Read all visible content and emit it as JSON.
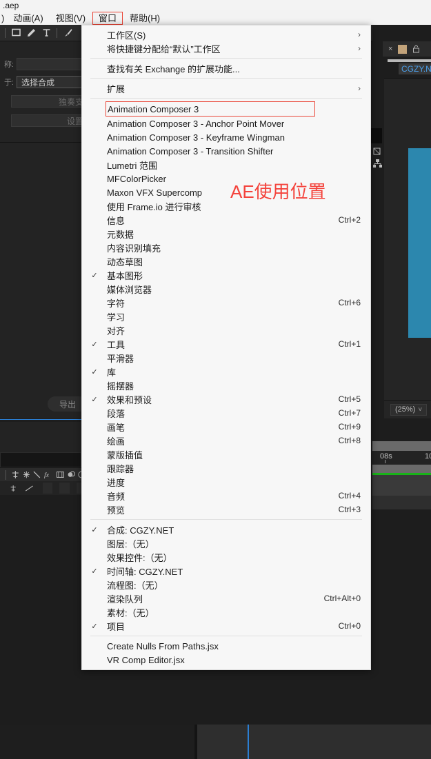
{
  "window": {
    "title": ".aep",
    "menubar": [
      {
        "label": ")",
        "active": false
      },
      {
        "label": "动画(A)",
        "active": false
      },
      {
        "label": "视图(V)",
        "active": false
      },
      {
        "label": "窗口",
        "active": true
      },
      {
        "label": "帮助(H)",
        "active": false
      }
    ]
  },
  "toolbar": {
    "tools": [
      "rectangle-tool",
      "pen-tool",
      "text-tool",
      "brush-tool"
    ]
  },
  "left_panel": {
    "rows": [
      {
        "label": "称:",
        "value": "",
        "placeholder": ""
      },
      {
        "label": "于:",
        "value": "选择合成",
        "placeholder": ""
      },
      {
        "label": "",
        "value": "独奏支",
        "placeholder": ""
      },
      {
        "label": "",
        "value": "设置",
        "placeholder": ""
      }
    ],
    "export_label": "导出"
  },
  "right_panel": {
    "comp_name": "CGZY.N",
    "zoom_level": "(25%)",
    "zoom_caret": "˅",
    "close_icon": "×",
    "lock_icon": "🔓"
  },
  "timeline": {
    "ruler_labels": [
      "08s",
      "10"
    ]
  },
  "annotation": {
    "text": "AE使用位置",
    "color": "#f4433c"
  },
  "menu": {
    "name": "window-menu",
    "groups": [
      {
        "items": [
          {
            "label": "工作区(S)",
            "accel": "",
            "checked": false,
            "submenu": true
          },
          {
            "label": "将快捷键分配给“默认”工作区",
            "accel": "",
            "checked": false,
            "submenu": true
          }
        ]
      },
      {
        "items": [
          {
            "label": "查找有关 Exchange 的扩展功能...",
            "accel": "",
            "checked": false,
            "submenu": false
          }
        ]
      },
      {
        "items": [
          {
            "label": "扩展",
            "accel": "",
            "checked": false,
            "submenu": true
          }
        ]
      },
      {
        "items": [
          {
            "label": "Animation Composer 3",
            "accel": "",
            "checked": false,
            "submenu": false,
            "highlight": true
          },
          {
            "label": "Animation Composer 3 - Anchor Point Mover",
            "accel": "",
            "checked": false,
            "submenu": false
          },
          {
            "label": "Animation Composer 3 - Keyframe Wingman",
            "accel": "",
            "checked": false,
            "submenu": false
          },
          {
            "label": "Animation Composer 3 - Transition Shifter",
            "accel": "",
            "checked": false,
            "submenu": false
          },
          {
            "label": "Lumetri 范围",
            "accel": "",
            "checked": false,
            "submenu": false
          },
          {
            "label": "MFColorPicker",
            "accel": "",
            "checked": false,
            "submenu": false
          },
          {
            "label": "Maxon VFX Supercomp",
            "accel": "",
            "checked": false,
            "submenu": false
          },
          {
            "label": "使用 Frame.io 进行审核",
            "accel": "",
            "checked": false,
            "submenu": false
          },
          {
            "label": "信息",
            "accel": "Ctrl+2",
            "checked": false,
            "submenu": false
          },
          {
            "label": "元数据",
            "accel": "",
            "checked": false,
            "submenu": false
          },
          {
            "label": "内容识别填充",
            "accel": "",
            "checked": false,
            "submenu": false
          },
          {
            "label": "动态草图",
            "accel": "",
            "checked": false,
            "submenu": false
          },
          {
            "label": "基本图形",
            "accel": "",
            "checked": true,
            "submenu": false
          },
          {
            "label": "媒体浏览器",
            "accel": "",
            "checked": false,
            "submenu": false
          },
          {
            "label": "字符",
            "accel": "Ctrl+6",
            "checked": false,
            "submenu": false
          },
          {
            "label": "学习",
            "accel": "",
            "checked": false,
            "submenu": false
          },
          {
            "label": "对齐",
            "accel": "",
            "checked": false,
            "submenu": false
          },
          {
            "label": "工具",
            "accel": "Ctrl+1",
            "checked": true,
            "submenu": false
          },
          {
            "label": "平滑器",
            "accel": "",
            "checked": false,
            "submenu": false
          },
          {
            "label": "库",
            "accel": "",
            "checked": true,
            "submenu": false
          },
          {
            "label": "摇摆器",
            "accel": "",
            "checked": false,
            "submenu": false
          },
          {
            "label": "效果和预设",
            "accel": "Ctrl+5",
            "checked": true,
            "submenu": false
          },
          {
            "label": "段落",
            "accel": "Ctrl+7",
            "checked": false,
            "submenu": false
          },
          {
            "label": "画笔",
            "accel": "Ctrl+9",
            "checked": false,
            "submenu": false
          },
          {
            "label": "绘画",
            "accel": "Ctrl+8",
            "checked": false,
            "submenu": false
          },
          {
            "label": "蒙版插值",
            "accel": "",
            "checked": false,
            "submenu": false
          },
          {
            "label": "跟踪器",
            "accel": "",
            "checked": false,
            "submenu": false
          },
          {
            "label": "进度",
            "accel": "",
            "checked": false,
            "submenu": false
          },
          {
            "label": "音频",
            "accel": "Ctrl+4",
            "checked": false,
            "submenu": false
          },
          {
            "label": "预览",
            "accel": "Ctrl+3",
            "checked": false,
            "submenu": false
          }
        ]
      },
      {
        "items": [
          {
            "label": "合成: CGZY.NET",
            "accel": "",
            "checked": true,
            "submenu": false
          },
          {
            "label": "图层:（无）",
            "accel": "",
            "checked": false,
            "submenu": false
          },
          {
            "label": "效果控件:（无）",
            "accel": "",
            "checked": false,
            "submenu": false
          },
          {
            "label": "时间轴: CGZY.NET",
            "accel": "",
            "checked": true,
            "submenu": false
          },
          {
            "label": "流程图:（无）",
            "accel": "",
            "checked": false,
            "submenu": false
          },
          {
            "label": "渲染队列",
            "accel": "Ctrl+Alt+0",
            "checked": false,
            "submenu": false
          },
          {
            "label": "素材:（无）",
            "accel": "",
            "checked": false,
            "submenu": false
          },
          {
            "label": "项目",
            "accel": "Ctrl+0",
            "checked": true,
            "submenu": false
          }
        ]
      },
      {
        "items": [
          {
            "label": "Create Nulls From Paths.jsx",
            "accel": "",
            "checked": false,
            "submenu": false
          },
          {
            "label": "VR Comp Editor.jsx",
            "accel": "",
            "checked": false,
            "submenu": false
          }
        ]
      }
    ]
  }
}
